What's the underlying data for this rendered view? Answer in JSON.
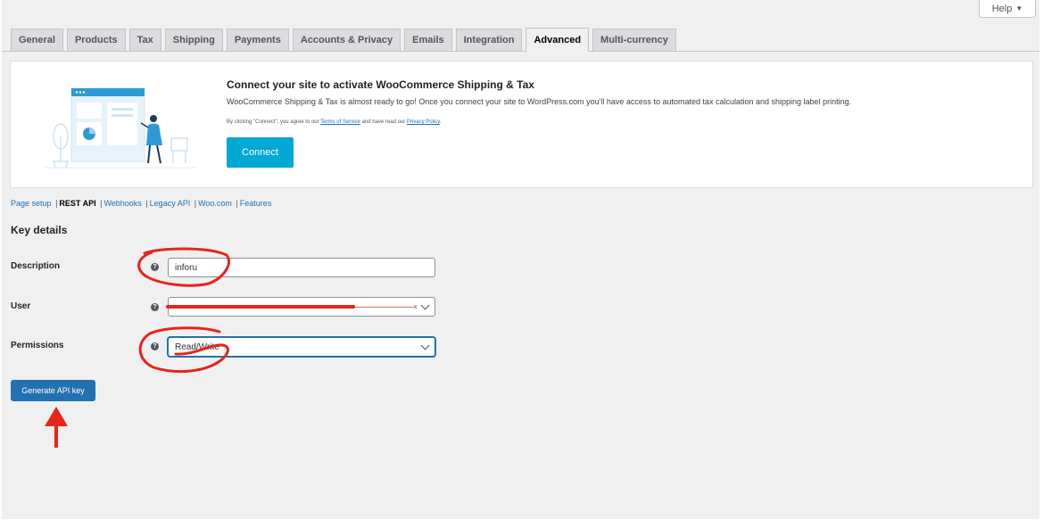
{
  "help": {
    "label": "Help",
    "caret": "▼"
  },
  "tabs": [
    {
      "label": "General",
      "active": false
    },
    {
      "label": "Products",
      "active": false
    },
    {
      "label": "Tax",
      "active": false
    },
    {
      "label": "Shipping",
      "active": false
    },
    {
      "label": "Payments",
      "active": false
    },
    {
      "label": "Accounts & Privacy",
      "active": false
    },
    {
      "label": "Emails",
      "active": false
    },
    {
      "label": "Integration",
      "active": false
    },
    {
      "label": "Advanced",
      "active": true
    },
    {
      "label": "Multi-currency",
      "active": false
    }
  ],
  "banner": {
    "title": "Connect your site to activate WooCommerce Shipping & Tax",
    "description": "WooCommerce Shipping & Tax is almost ready to go! Once you connect your site to WordPress.com you'll have access to automated tax calculation and shipping label printing.",
    "legal_prefix": "By clicking \"Connect\", you agree to our",
    "terms_link": "Terms of Service",
    "legal_middle": "and have read our",
    "privacy_link": "Privacy Policy",
    "legal_suffix": ".",
    "connect_label": "Connect"
  },
  "subnav": {
    "items": [
      {
        "label": "Page setup",
        "current": false
      },
      {
        "label": "REST API",
        "current": true
      },
      {
        "label": "Webhooks",
        "current": false
      },
      {
        "label": "Legacy API",
        "current": false
      },
      {
        "label": "Woo.com",
        "current": false
      },
      {
        "label": "Features",
        "current": false
      }
    ],
    "separator": "|"
  },
  "key_details": {
    "title": "Key details",
    "description_label": "Description",
    "description_value": "inforu",
    "user_label": "User",
    "user_value": "————————————————————————————",
    "user_clear": "×",
    "permissions_label": "Permissions",
    "permissions_value": "Read/Write",
    "help_icon": "?",
    "generate_label": "Generate API key"
  },
  "colors": {
    "wp_blue": "#2271b1",
    "connect_cyan": "#00a8d4",
    "annotation_red": "#e8231b"
  },
  "icons": [
    "question-circle-icon",
    "chevron-down-icon",
    "clear-x-icon",
    "help-caret-icon"
  ]
}
